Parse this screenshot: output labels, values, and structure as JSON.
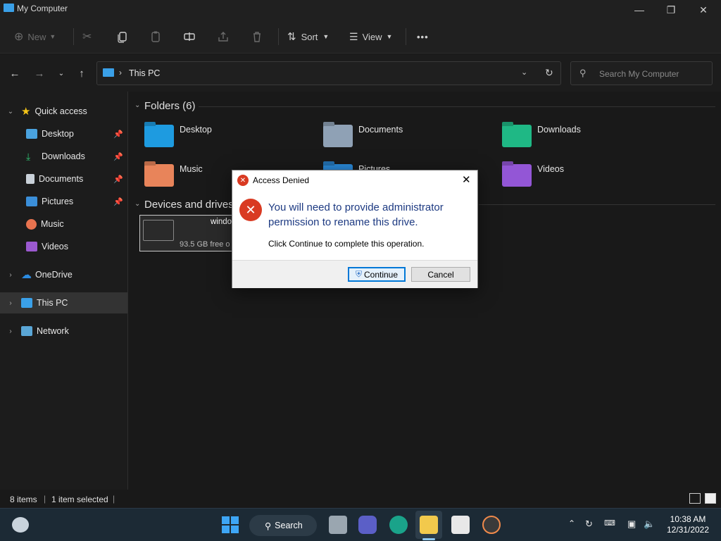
{
  "window": {
    "title": "My Computer"
  },
  "toolbar": {
    "new_label": "New",
    "sort_label": "Sort",
    "view_label": "View",
    "more_label": "•••"
  },
  "address": {
    "location": "This PC"
  },
  "search": {
    "placeholder": "Search My Computer"
  },
  "sidebar": {
    "quick_access": "Quick access",
    "items": [
      {
        "label": "Desktop",
        "color": "#4aa3df"
      },
      {
        "label": "Downloads",
        "color": "#2fbf71"
      },
      {
        "label": "Documents",
        "color": "#c9d1d9"
      },
      {
        "label": "Pictures",
        "color": "#3b8fd9"
      },
      {
        "label": "Music",
        "color": "#e8734f"
      },
      {
        "label": "Videos",
        "color": "#9b59d0"
      }
    ],
    "onedrive": "OneDrive",
    "this_pc": "This PC",
    "network": "Network"
  },
  "content": {
    "folders_header": "Folders (6)",
    "folders": [
      {
        "label": "Desktop",
        "color": "#1e9be0"
      },
      {
        "label": "Documents",
        "color": "#8fa1b5"
      },
      {
        "label": "Downloads",
        "color": "#1fb885"
      },
      {
        "label": "Music",
        "color": "#e8845a"
      },
      {
        "label": "Pictures",
        "color": "#2a88d6"
      },
      {
        "label": "Videos",
        "color": "#9356d6"
      }
    ],
    "devices_header": "Devices and drives",
    "drive": {
      "name": "windo",
      "free": "93.5 GB free o"
    }
  },
  "dialog": {
    "title": "Access Denied",
    "message": "You will need to provide administrator permission to rename this drive.",
    "detail": "Click Continue to complete this operation.",
    "continue_label": "Continue",
    "cancel_label": "Cancel"
  },
  "status": {
    "items": "8 items",
    "selected": "1 item selected"
  },
  "taskbar": {
    "search_label": "Search",
    "time": "10:38 AM",
    "date": "12/31/2022"
  }
}
